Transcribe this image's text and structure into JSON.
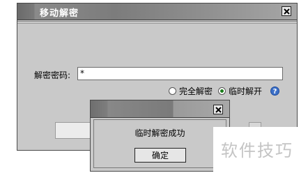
{
  "main_window": {
    "title": "移动解密",
    "password_label": "解密密码:",
    "password_value": "*",
    "options": [
      {
        "label": "完全解密",
        "checked": false
      },
      {
        "label": "临时解开",
        "checked": true
      }
    ],
    "help_icon": "question-icon"
  },
  "popup": {
    "message": "临时解密成功",
    "ok_label": "确定"
  },
  "watermark": {
    "text": "软件技巧"
  },
  "colors": {
    "window_bg": "#c9c9c9",
    "titlebar": "#7c7c7c",
    "radio_selected": "#1a7d1a",
    "help": "#3b6fc7"
  }
}
